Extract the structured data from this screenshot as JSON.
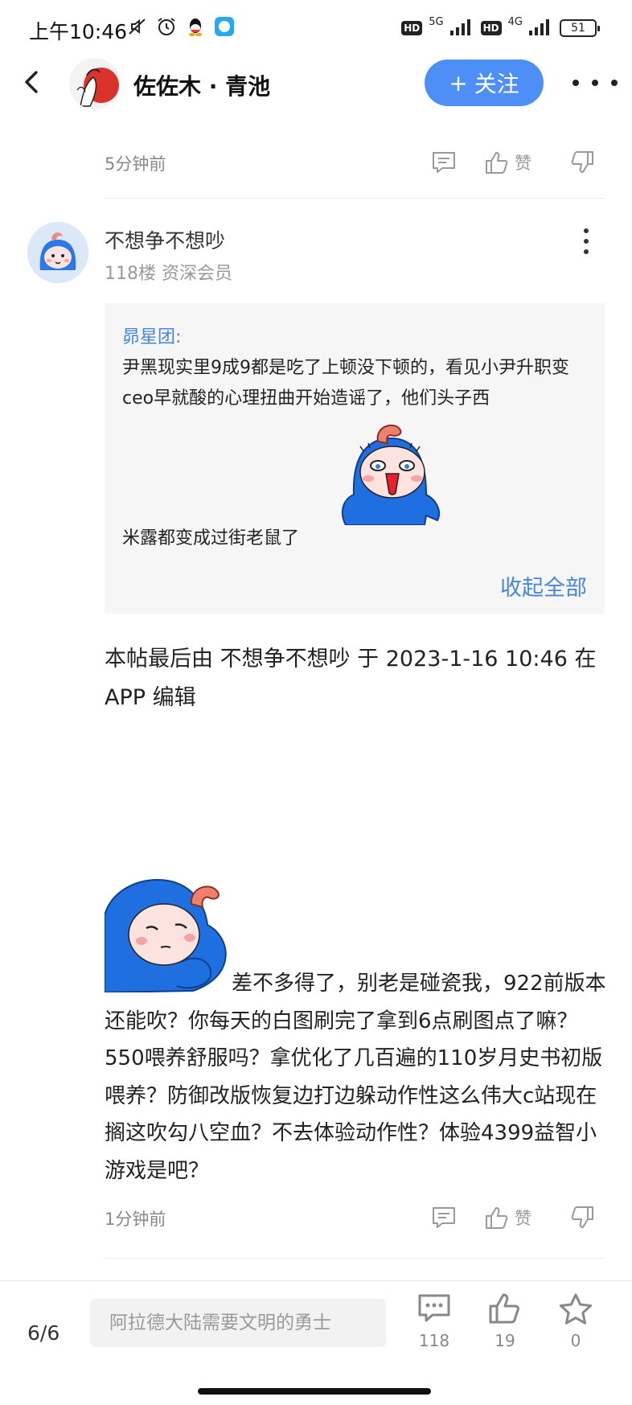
{
  "status_bar": {
    "time": "上午10:46",
    "signal_5g": "5G",
    "signal_4g": "4G",
    "hd": "HD",
    "battery": "51"
  },
  "header": {
    "title": "佐佐木 · 青池",
    "follow_plus": "+",
    "follow_label": "关注"
  },
  "prev_comment": {
    "time": "5分钟前",
    "like_label": "赞"
  },
  "comment": {
    "author": "不想争不想吵",
    "floor_info": "118楼 资深会员",
    "quote": {
      "author": "昴星团:",
      "text": "尹黑现实里9成9都是吃了上顿没下顿的，看见小尹升职变ceo早就酸的心理扭曲开始造谣了，他们头子西",
      "text_tail": "米露都变成过街老鼠了",
      "collapse_label": "收起全部"
    },
    "edit_note": "本帖最后由 不想争不想吵 于 2023-1-16 10:46 在APP 编辑",
    "body": "差不多得了，别老是碰瓷我，922前版本还能吹？你每天的白图刷完了拿到6点刷图点了嘛？550喂养舒服吗？拿优化了几百遍的110岁月史书初版喂养？防御改版恢复边打边躲动作性这么伟大c站现在搁这吹勾八空血？不去体验动作性？体验4399益智小游戏是吧？",
    "time": "1分钟前",
    "like_label": "赞"
  },
  "bottom_bar": {
    "page_indicator": "6/6",
    "reply_placeholder": "阿拉德大陆需要文明的勇士",
    "comment_count": "118",
    "like_count": "19",
    "favorite_count": "0"
  },
  "colors": {
    "accent": "#4d8ef7",
    "link": "#4a86d6",
    "sticker_blue": "#1f6fe0"
  }
}
